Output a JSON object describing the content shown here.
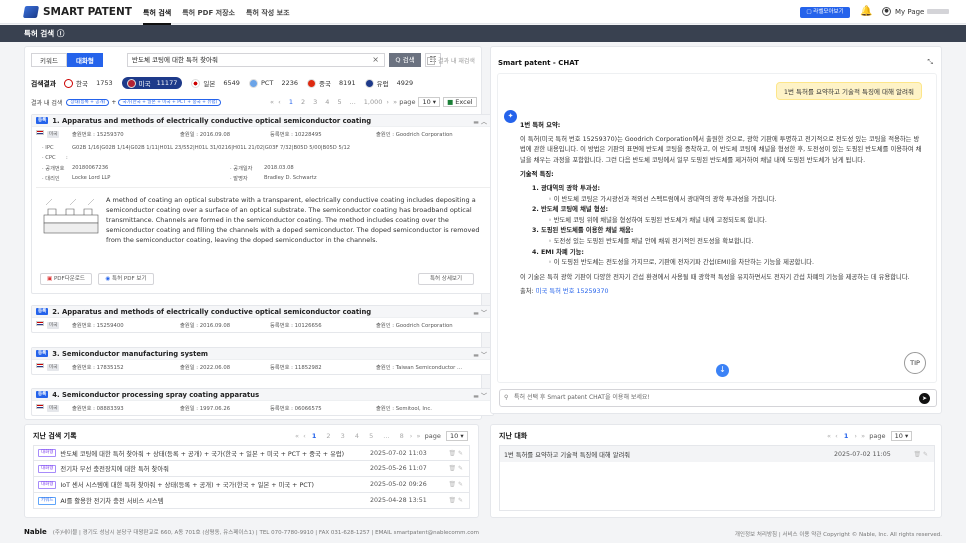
{
  "app": {
    "logo": "SMART PATENT"
  },
  "nav": [
    "특허 검색",
    "특허 PDF 저장소",
    "특허 작성 보조"
  ],
  "top": {
    "tutorial": "▢ 라벨모아보기",
    "mypage": "My Page"
  },
  "bar": {
    "title": "특허 검색"
  },
  "search": {
    "mode": [
      "키워드",
      "대화형"
    ],
    "query": "반도체 코팅에 대한 특허 찾아줘",
    "button": "Q 검색",
    "within": "결과 내 재검색"
  },
  "results_label": "검색결과",
  "countries": [
    {
      "name": "한국",
      "count": "1753",
      "color": "#ffffff"
    },
    {
      "name": "미국",
      "count": "11177",
      "color": "#b22234"
    },
    {
      "name": "일본",
      "count": "6549",
      "color": "#ffffff"
    },
    {
      "name": "PCT",
      "count": "2236",
      "color": "#6ba4e8"
    },
    {
      "name": "중국",
      "count": "8191",
      "color": "#de2910"
    },
    {
      "name": "유럽",
      "count": "4929",
      "color": "#1e3a8a"
    }
  ],
  "within_label": "결과 내 검색",
  "chips": [
    "상태(등록 + 공개)",
    "국가(한국 + 일본 + 미국 + PCT + 중국 + 유럽)"
  ],
  "pager": {
    "pages": [
      "1",
      "2",
      "3",
      "4",
      "5",
      "...",
      "1,000"
    ],
    "page_label": "page",
    "size": "10",
    "excel": "Excel"
  },
  "results": [
    {
      "badge": "등록",
      "title": "1. Apparatus and methods of electrically conductive optical semiconductor coating",
      "country": "미국",
      "appno": "출원번호 : 15259370",
      "appdate": "출원일 : 2016.09.08",
      "regno": "등록번호 : 10228495",
      "applicant": "출원인 : Goodrich Corporation",
      "ipc_label": "· IPC",
      "ipc": "G02B 1/16|G02B 1/14|G02B 1/11|H01L 23/552|H01L 31/0216|H01L 21/02|G03F 7/32|B05D 5/00|B05D 5/12",
      "cpc_label": "· CPC",
      "cpc": ":",
      "pubno_label": "· 공개번호",
      "pubno": "20180067236",
      "agent_label": "· 대리인",
      "agent": "Locke Lord LLP",
      "pubdate_label": "· 공개일자",
      "pubdate": "2018.03.08",
      "inventor_label": "· 발명자",
      "inventor": "Bradley D. Schwartz",
      "abstract": "A method of coating an optical substrate with a transparent, electrically conductive coating includes depositing a semiconductor coating over a surface of an optical substrate. The semiconductor coating has broadband optical transmittance. Channels are formed in the semiconductor coating. The method includes coating over the semiconductor coating and filling the channels with a doped semiconductor. The doped semiconductor is removed from the semiconductor coating, leaving the doped semiconductor in the channels.",
      "pdf": "PDF다운로드",
      "view": "특허 PDF 보기",
      "detail": "특허 상세보기"
    },
    {
      "badge": "등록",
      "title": "2. Apparatus and methods of electrically conductive optical semiconductor coating",
      "country": "미국",
      "appno": "출원번호 : 15259400",
      "appdate": "출원일 : 2016.09.08",
      "regno": "등록번호 : 10126656",
      "applicant": "출원인 : Goodrich Corporation"
    },
    {
      "badge": "등록",
      "title": "3. Semiconductor manufacturing system",
      "country": "미국",
      "appno": "출원번호 : 17835152",
      "appdate": "출원일 : 2022.06.08",
      "regno": "등록번호 : 11852982",
      "applicant": "출원인 : Taiwan Semiconductor ..."
    },
    {
      "badge": "등록",
      "title": "4. Semiconductor processing spray coating apparatus",
      "country": "미국",
      "appno": "출원번호 : 08883393",
      "appdate": "출원일 : 1997.06.26",
      "regno": "등록번호 : 06066575",
      "applicant": "출원인 : Semitool, Inc."
    }
  ],
  "chat": {
    "title": "Smart patent - CHAT",
    "question": "1번 특허를 요약하고 기술적 특징에 대해 알려줘",
    "summary_h": "1번 특허 요약:",
    "summary": "이 특허(미국 특허 번호 15259370)는 Goodrich Corporation에서 출원한 것으로, 광학 기판에 투명하고 전기적으로 전도성 있는 코팅을 적용하는 방법에 관한 내용입니다. 이 방법은 기판의 표면에 반도체 코팅을 증착하고, 이 반도체 코팅에 채널을 형성한 후, 도전성이 있는 도핑된 반도체를 이용하여 채널을 채우는 과정을 포함합니다. 그런 다음 반도체 코팅에서 일부 도핑된 반도체를 제거하여 채널 내에 도핑된 반도체가 남게 됩니다.",
    "feat_h": "기술적 특징:",
    "features": [
      {
        "t": "1. 광대역의 광학 투과성:",
        "d": "이 반도체 코팅은 가시광선과 적외선 스펙트럼에서 광대역의 광학 투과성을 가집니다."
      },
      {
        "t": "2. 반도체 코팅에 채널 형성:",
        "d": "반도체 코팅 위에 채널을 형성하여 도핑된 반도체가 채널 내에 고정되도록 합니다."
      },
      {
        "t": "3. 도핑된 반도체를 이용한 채널 채움:",
        "d": "도전성 있는 도핑된 반도체를 채널 안에 채워 전기적인 전도성을 확보합니다."
      },
      {
        "t": "4. EMI 차폐 기능:",
        "d": "이 도핑된 반도체는 전도성을 가지므로, 기판에 전자기파 간섭(EMI)을 차단하는 기능을 제공합니다."
      }
    ],
    "conclusion": "이 기술은 특히 광학 기판이 다양한 전자기 간섭 환경에서 사용될 때 광학적 특성을 유지하면서도 전자기 간섭 차폐의 기능을 제공하는 데 유용합니다.",
    "source_label": "출처:",
    "source": "미국 특허 번호 15259370",
    "tip": "TIP",
    "placeholder": "특허 선택 후 Smart patent CHAT을 이용해 보세요!"
  },
  "history": {
    "title": "지난 검색 기록",
    "pages": [
      "1",
      "2",
      "3",
      "4",
      "5",
      "...",
      "8"
    ],
    "page_label": "page",
    "size": "10",
    "rows": [
      {
        "tag": "대화형",
        "text": "반도체 코팅에 대한 특허 찾아줘 + 상태(등록 + 공개) + 국가(한국 + 일본 + 미국 + PCT + 중국 + 유럽)",
        "date": "2025-07-02 11:03"
      },
      {
        "tag": "대화형",
        "text": "전기차 무선 충전장치에 대한 특허 찾아줘",
        "date": "2025-05-26 11:07"
      },
      {
        "tag": "대화형",
        "text": "IoT 센서 시스템에 대한 특허 찾아줘 + 상태(등록 + 공개) + 국가(한국 + 일본 + 미국 + PCT)",
        "date": "2025-05-02 09:26"
      },
      {
        "tag": "키워드",
        "text": "AI를 활용한 전기차 충전 서비스 시스템",
        "date": "2025-04-28 13:51"
      }
    ]
  },
  "chat_history": {
    "title": "지난 대화",
    "page": "1",
    "page_label": "page",
    "size": "10",
    "rows": [
      {
        "text": "1번 특허를 요약하고 기술적 특징에 대해 알려줘",
        "date": "2025-07-02 11:05"
      }
    ]
  },
  "footer": {
    "brand": "Nable",
    "info": "(주)네이블 | 경기도 성남시 분당구 대왕판교로 660, A동 701호 (삼평동, 유스페이스1) | TEL 070-7780-9910 | FAX 031-628-1257 | EMAIL smartpatent@nablecomm.com",
    "right": "개인정보 처리방침 | 서비스 이용 약관 Copyright © Nable, Inc. All rights reserved."
  }
}
